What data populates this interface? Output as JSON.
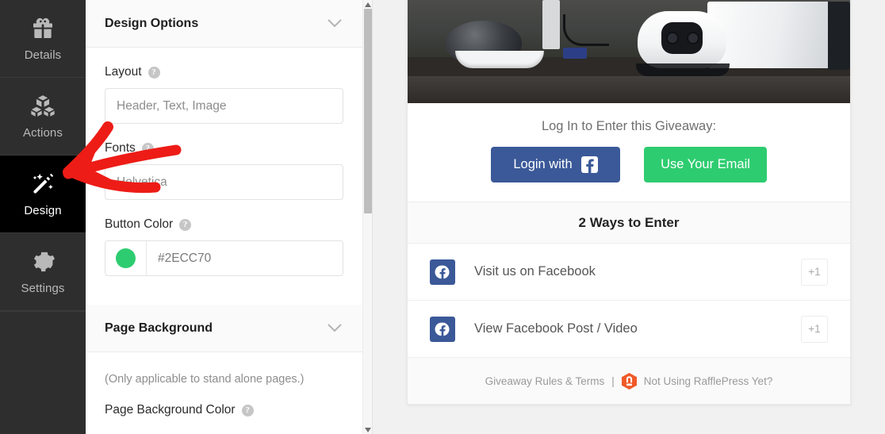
{
  "nav": {
    "items": [
      {
        "label": "Details",
        "icon": "gift-icon",
        "active": false
      },
      {
        "label": "Actions",
        "icon": "blocks-icon",
        "active": false
      },
      {
        "label": "Design",
        "icon": "design-wand-icon",
        "active": true
      },
      {
        "label": "Settings",
        "icon": "gear-icon",
        "active": false
      }
    ]
  },
  "panel": {
    "design_options": {
      "title": "Design Options",
      "layout": {
        "label": "Layout",
        "value": "Header, Text, Image",
        "help": "?"
      },
      "fonts": {
        "label": "Fonts",
        "value": "Helvetica",
        "help": "?"
      },
      "button_color": {
        "label": "Button Color",
        "value": "#2ECC70",
        "swatch": "#2ECC70",
        "help": "?"
      }
    },
    "page_background": {
      "title": "Page Background",
      "note": "(Only applicable to stand alone pages.)",
      "page_background_color": {
        "label": "Page Background Color",
        "help": "?"
      }
    }
  },
  "preview": {
    "hero_alt": "PlayStation 5 console with headset and controller on a wooden desk",
    "login": {
      "title": "Log In to Enter this Giveaway:",
      "facebook_button": "Login with",
      "email_button": "Use Your Email"
    },
    "ways": {
      "title": "2 Ways to Enter"
    },
    "entries": [
      {
        "label": "Visit us on Facebook",
        "points": "+1",
        "icon": "facebook-icon"
      },
      {
        "label": "View Facebook Post / Video",
        "points": "+1",
        "icon": "facebook-icon"
      }
    ],
    "footer": {
      "rules_link": "Giveaway Rules & Terms",
      "separator": "|",
      "promo_link": "Not Using RafflePress Yet?",
      "logo": "rafflepress-logo-icon"
    }
  },
  "annotation": {
    "arrow_color": "#ED1C16",
    "points_to": "Design"
  }
}
